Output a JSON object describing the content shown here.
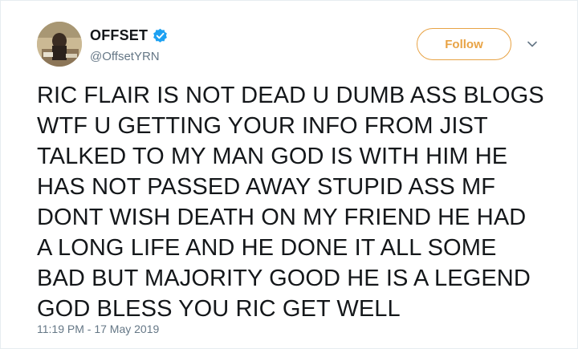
{
  "tweet": {
    "display_name": "OFFSET",
    "handle": "@OffsetYRN",
    "follow_label": "Follow",
    "text": "RIC FLAIR IS NOT DEAD U DUMB ASS BLOGS\nWTF U GETTING YOUR INFO FROM JIST\nTALKED TO MY MAN GOD IS WITH HIM HE\nHAS NOT PASSED AWAY STUPID ASS MF\nDONT WISH DEATH ON MY FRIEND HE HAD\nA LONG LIFE AND HE DONE IT ALL SOME\nBAD BUT MAJORITY GOOD HE IS A LEGEND\nGOD BLESS YOU RIC GET WELL",
    "timestamp": "11:19 PM - 17 May 2019"
  },
  "icons": {
    "verified": "verified-badge-icon",
    "menu": "chevron-down-icon"
  },
  "colors": {
    "follow_accent": "#e8a345",
    "verified_blue": "#1da1f2",
    "secondary_text": "#657786",
    "primary_text": "#14171a"
  }
}
